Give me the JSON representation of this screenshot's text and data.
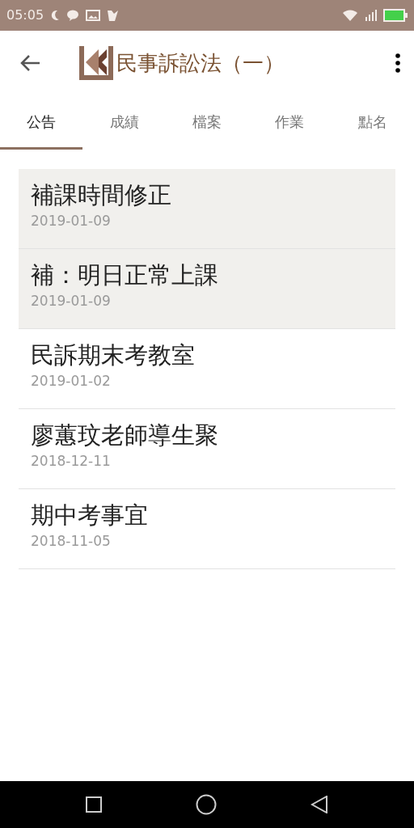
{
  "status_bar": {
    "time": "05:05"
  },
  "toolbar": {
    "title": "民事訴訟法（一）"
  },
  "tabs": [
    {
      "label": "公告",
      "selected": true
    },
    {
      "label": "成績",
      "selected": false
    },
    {
      "label": "檔案",
      "selected": false
    },
    {
      "label": "作業",
      "selected": false
    },
    {
      "label": "點名",
      "selected": false
    }
  ],
  "announcements": [
    {
      "title": "補課時間修正",
      "date": "2019-01-09",
      "highlighted": true
    },
    {
      "title": "補：明日正常上課",
      "date": "2019-01-09",
      "highlighted": true
    },
    {
      "title": "民訴期末考教室",
      "date": "2019-01-02",
      "highlighted": false
    },
    {
      "title": "廖蕙玟老師導生聚",
      "date": "2018-12-11",
      "highlighted": false
    },
    {
      "title": "期中考事宜",
      "date": "2018-11-05",
      "highlighted": false
    }
  ]
}
